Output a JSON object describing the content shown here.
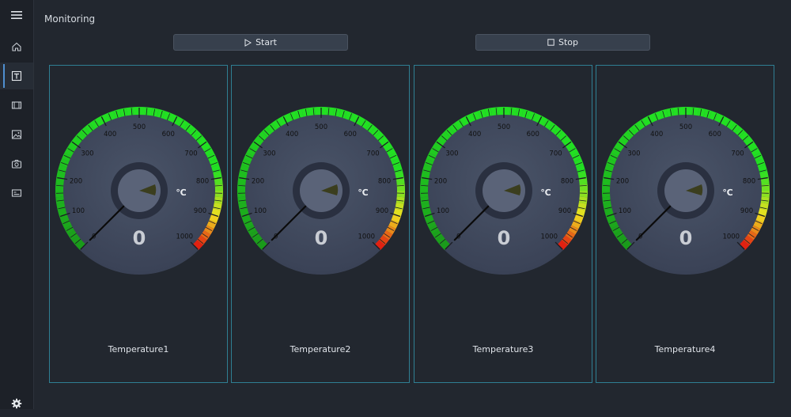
{
  "app": {
    "title": "Monitoring"
  },
  "sidebar": {
    "items": [
      {
        "icon": "menu-icon"
      },
      {
        "icon": "home-icon"
      },
      {
        "icon": "text-icon"
      },
      {
        "icon": "film-icon"
      },
      {
        "icon": "image-icon"
      },
      {
        "icon": "camera-icon"
      },
      {
        "icon": "id-card-icon"
      },
      {
        "icon": "gear-icon"
      }
    ]
  },
  "controls": {
    "start_label": "Start",
    "stop_label": "Stop"
  },
  "gauges": [
    {
      "label": "Temperature1",
      "value": "0",
      "unit": "℃"
    },
    {
      "label": "Temperature2",
      "value": "0",
      "unit": "℃"
    },
    {
      "label": "Temperature3",
      "value": "0",
      "unit": "℃"
    },
    {
      "label": "Temperature4",
      "value": "0",
      "unit": "℃"
    }
  ],
  "gauge_scale": {
    "min": 0,
    "max": 1000,
    "ticks": [
      "0",
      "100",
      "200",
      "300",
      "400",
      "500",
      "600",
      "700",
      "800",
      "900",
      "1000"
    ],
    "colors": {
      "low": "#1a9a1a",
      "mid": "#22e022",
      "high": "#f0e020",
      "max": "#e01010"
    }
  }
}
